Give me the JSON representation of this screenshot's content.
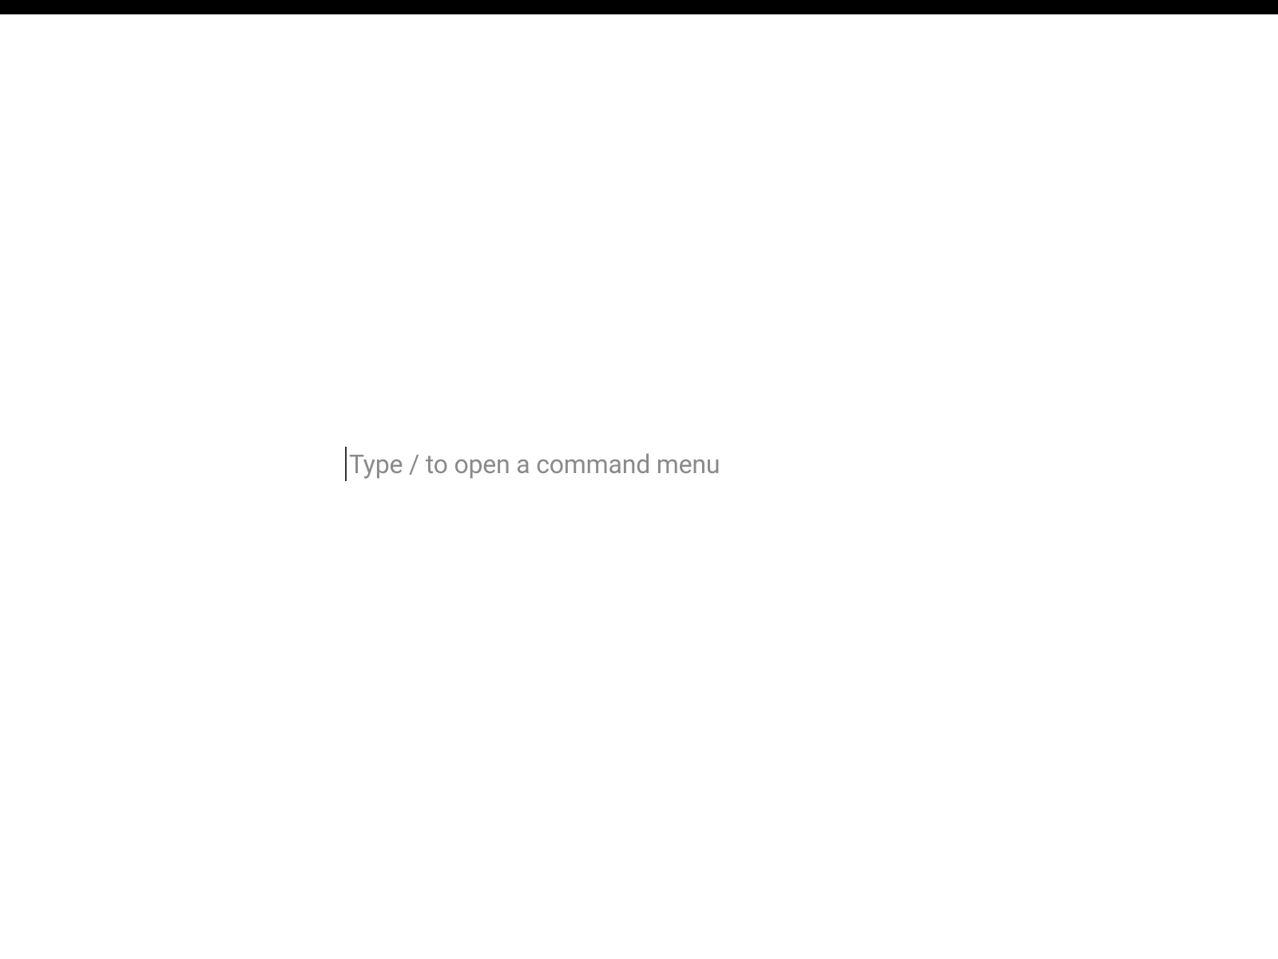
{
  "editor": {
    "placeholder": "Type / to open a command menu"
  }
}
